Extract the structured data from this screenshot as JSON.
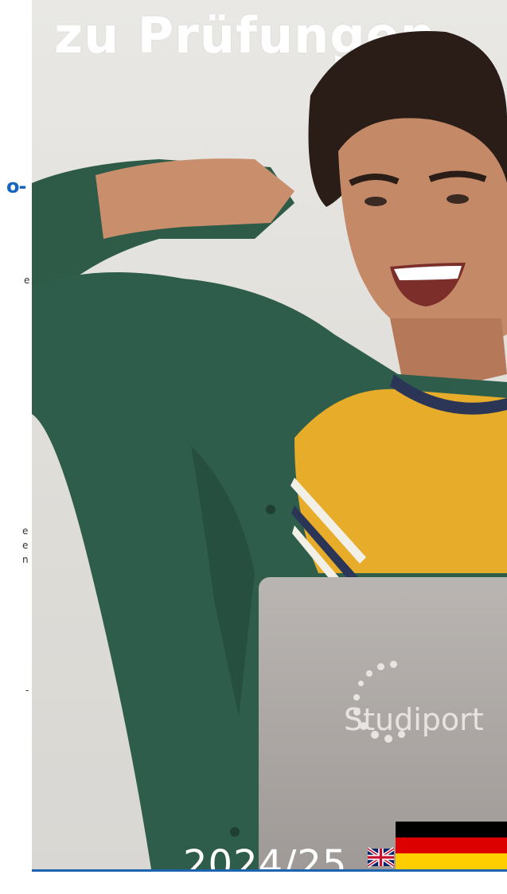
{
  "headline": "zu Prüfungen",
  "left_fragments": {
    "blue": "o-",
    "f1": "e",
    "f2": "e",
    "f3": "e",
    "f4": "n",
    "f5": "-"
  },
  "laptop": {
    "brand": "Studiport"
  },
  "footer": {
    "year": "2024/25"
  },
  "colors": {
    "blue_accent": "#1565c0",
    "shirt_green": "#2f5d4b",
    "tshirt_yellow": "#e7ac2a",
    "laptop_gray": "#aaa5a2"
  },
  "icons": {
    "uk_flag": "uk-flag-icon",
    "de_flag": "germany-flag-icon"
  }
}
